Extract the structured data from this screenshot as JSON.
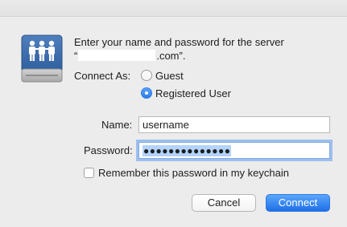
{
  "dialog": {
    "prompt_line1": "Enter your name and password for the server",
    "prompt_line2_open": "“",
    "prompt_line2_close": ".com”.",
    "connect_as_label": "Connect As:",
    "options": [
      {
        "label": "Guest",
        "selected": false
      },
      {
        "label": "Registered User",
        "selected": true
      }
    ],
    "name_label": "Name:",
    "name_value": "username",
    "password_label": "Password:",
    "password_value": "●●●●●●●●●●●●●●",
    "remember_label": "Remember this password in my keychain",
    "remember_checked": false,
    "cancel_label": "Cancel",
    "connect_label": "Connect"
  },
  "icon": "file-server-icon",
  "colors": {
    "accent": "#2c7de8",
    "selection": "#b3d3fb",
    "background": "#ececec"
  }
}
